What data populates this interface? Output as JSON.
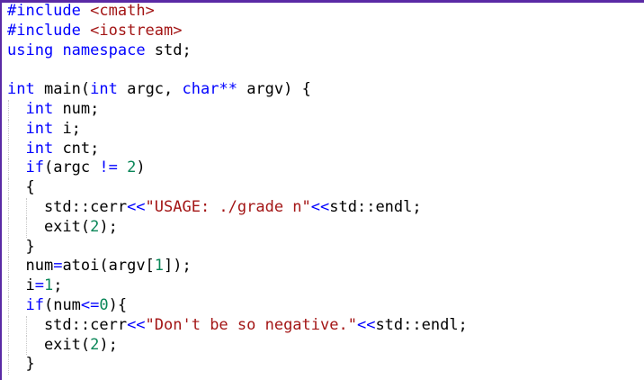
{
  "editor": {
    "accent_color": "#5a2aa5",
    "lines": [
      {
        "tokens": [
          {
            "t": "#include",
            "c": "pp"
          },
          {
            "t": " "
          },
          {
            "t": "<cmath>",
            "c": "str"
          }
        ]
      },
      {
        "tokens": [
          {
            "t": "#include",
            "c": "pp"
          },
          {
            "t": " "
          },
          {
            "t": "<iostream>",
            "c": "str"
          }
        ]
      },
      {
        "tokens": [
          {
            "t": "using",
            "c": "kw"
          },
          {
            "t": " "
          },
          {
            "t": "namespace",
            "c": "kw"
          },
          {
            "t": " std;"
          }
        ]
      },
      {
        "tokens": []
      },
      {
        "tokens": [
          {
            "t": "int",
            "c": "kw"
          },
          {
            "t": " main("
          },
          {
            "t": "int",
            "c": "kw"
          },
          {
            "t": " argc, "
          },
          {
            "t": "char",
            "c": "kw"
          },
          {
            "t": "**",
            "c": "op"
          },
          {
            "t": " argv) {"
          }
        ]
      },
      {
        "guides": [],
        "tokens": [
          {
            "t": "  "
          },
          {
            "t": "int",
            "c": "kw"
          },
          {
            "t": " num;"
          }
        ]
      },
      {
        "guides": [],
        "tokens": [
          {
            "t": "  "
          },
          {
            "t": "int",
            "c": "kw"
          },
          {
            "t": " i;"
          }
        ]
      },
      {
        "guides": [],
        "tokens": [
          {
            "t": "  "
          },
          {
            "t": "int",
            "c": "kw"
          },
          {
            "t": " cnt;"
          }
        ]
      },
      {
        "guides": [],
        "tokens": [
          {
            "t": "  "
          },
          {
            "t": "if",
            "c": "kw"
          },
          {
            "t": "(argc "
          },
          {
            "t": "!=",
            "c": "op"
          },
          {
            "t": " "
          },
          {
            "t": "2",
            "c": "num"
          },
          {
            "t": ")"
          }
        ]
      },
      {
        "guides": [],
        "tokens": [
          {
            "t": "  {"
          }
        ]
      },
      {
        "guides": [
          "g2"
        ],
        "tokens": [
          {
            "t": "    std::cerr"
          },
          {
            "t": "<<",
            "c": "op"
          },
          {
            "t": "\"USAGE: ./grade n\"",
            "c": "str"
          },
          {
            "t": "<<",
            "c": "op"
          },
          {
            "t": "std::endl;"
          }
        ]
      },
      {
        "guides": [
          "g2"
        ],
        "tokens": [
          {
            "t": "    exit("
          },
          {
            "t": "2",
            "c": "num"
          },
          {
            "t": ");"
          }
        ]
      },
      {
        "guides": [],
        "tokens": [
          {
            "t": "  }"
          }
        ]
      },
      {
        "guides": [],
        "tokens": [
          {
            "t": "  num"
          },
          {
            "t": "=",
            "c": "op"
          },
          {
            "t": "atoi(argv["
          },
          {
            "t": "1",
            "c": "num"
          },
          {
            "t": "]);"
          }
        ]
      },
      {
        "guides": [],
        "tokens": [
          {
            "t": "  i"
          },
          {
            "t": "=",
            "c": "op"
          },
          {
            "t": "1",
            "c": "num"
          },
          {
            "t": ";"
          }
        ]
      },
      {
        "guides": [],
        "tokens": [
          {
            "t": "  "
          },
          {
            "t": "if",
            "c": "kw"
          },
          {
            "t": "(num"
          },
          {
            "t": "<=",
            "c": "op"
          },
          {
            "t": "0",
            "c": "num"
          },
          {
            "t": "){"
          }
        ]
      },
      {
        "guides": [
          "g2"
        ],
        "tokens": [
          {
            "t": "    std::cerr"
          },
          {
            "t": "<<",
            "c": "op"
          },
          {
            "t": "\"Don't be so negative.\"",
            "c": "str"
          },
          {
            "t": "<<",
            "c": "op"
          },
          {
            "t": "std::endl;"
          }
        ]
      },
      {
        "guides": [
          "g2"
        ],
        "tokens": [
          {
            "t": "    exit("
          },
          {
            "t": "2",
            "c": "num"
          },
          {
            "t": ");"
          }
        ]
      },
      {
        "guides": [],
        "tokens": [
          {
            "t": "  }"
          }
        ]
      }
    ]
  }
}
